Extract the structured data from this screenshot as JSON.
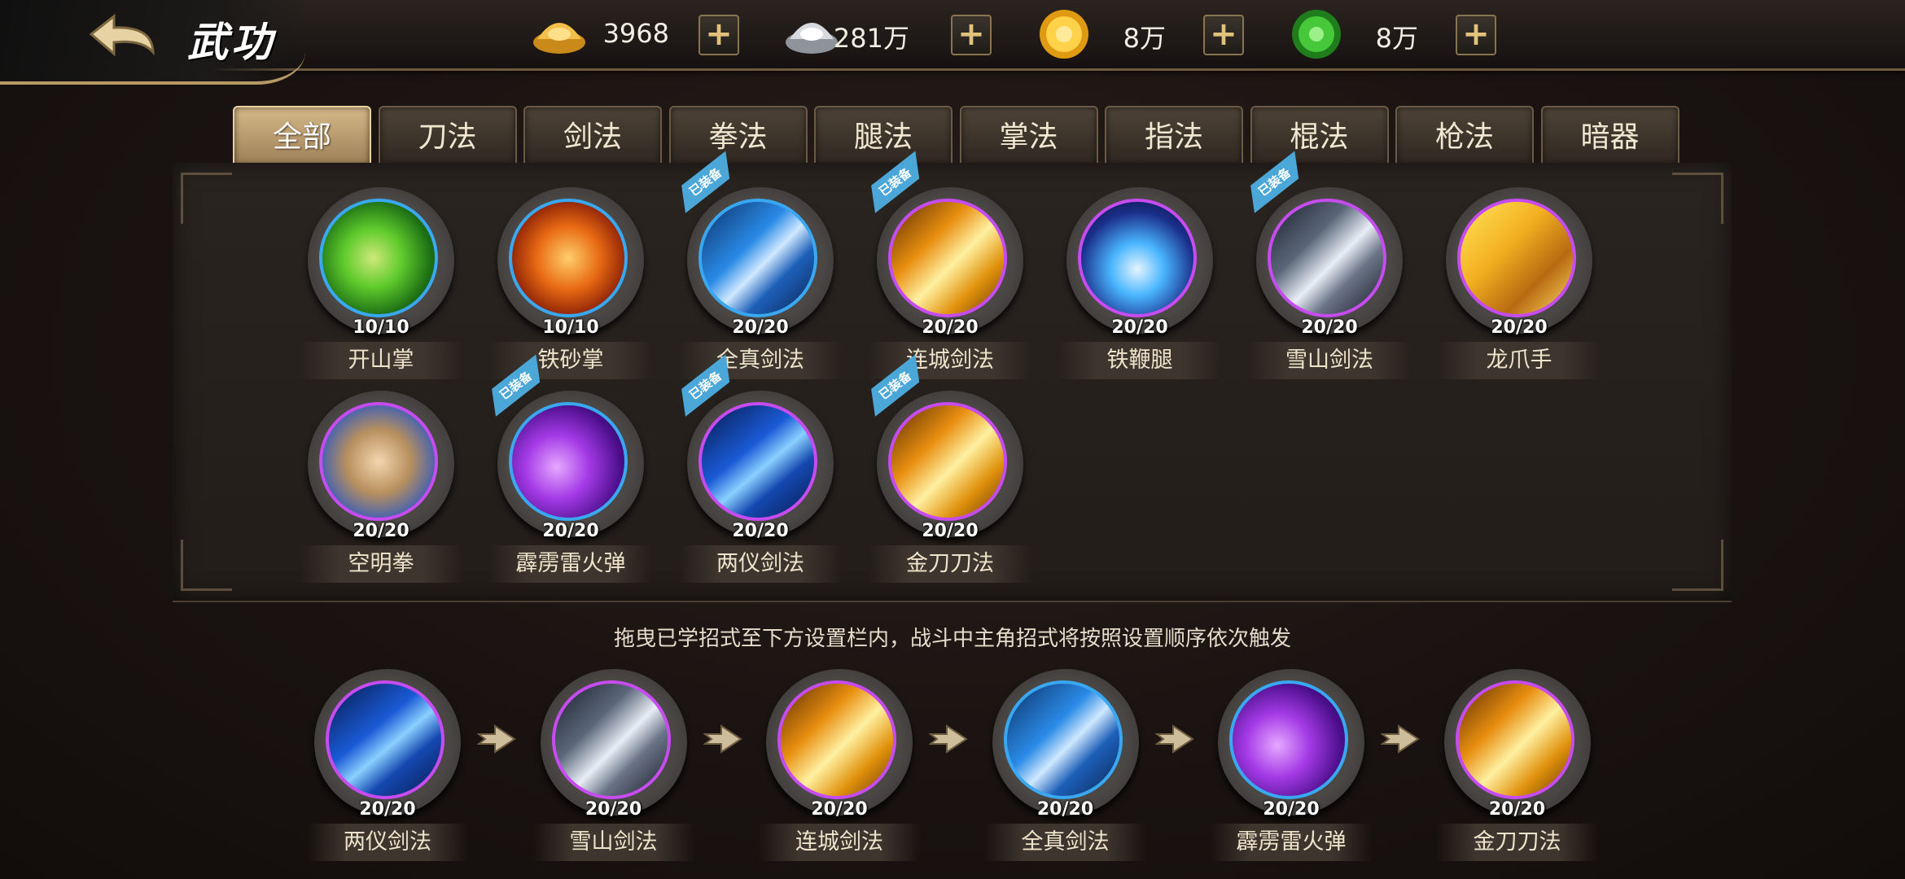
{
  "header": {
    "title": "武功",
    "currencies": [
      {
        "icon": "gold-ingot-icon",
        "value": "3968",
        "color": "#e8b43a"
      },
      {
        "icon": "silver-ingot-icon",
        "value": "281万",
        "color": "#c9ccd2"
      },
      {
        "icon": "gold-coin-icon",
        "value": "8万",
        "color": "#f1b51d"
      },
      {
        "icon": "green-jade-icon",
        "value": "8万",
        "color": "#3fbf35"
      }
    ]
  },
  "tabs": [
    "全部",
    "刀法",
    "剑法",
    "拳法",
    "腿法",
    "掌法",
    "指法",
    "棍法",
    "枪法",
    "暗器"
  ],
  "active_tab": 0,
  "equipped_label": "已装备",
  "skills": [
    {
      "name": "开山掌",
      "level": "10/10",
      "theme": "green",
      "ring": "blue",
      "equipped": false
    },
    {
      "name": "铁砂掌",
      "level": "10/10",
      "theme": "fire",
      "ring": "blue",
      "equipped": false
    },
    {
      "name": "全真剑法",
      "level": "20/20",
      "theme": "ice",
      "ring": "blue",
      "equipped": true
    },
    {
      "name": "连城剑法",
      "level": "20/20",
      "theme": "gold",
      "ring": "purple",
      "equipped": true
    },
    {
      "name": "铁鞭腿",
      "level": "20/20",
      "theme": "storm",
      "ring": "purple",
      "equipped": false
    },
    {
      "name": "雪山剑法",
      "level": "20/20",
      "theme": "silver",
      "ring": "purple",
      "equipped": true
    },
    {
      "name": "龙爪手",
      "level": "20/20",
      "theme": "amber",
      "ring": "purple",
      "equipped": false
    },
    {
      "name": "空明拳",
      "level": "20/20",
      "theme": "fist",
      "ring": "purple",
      "equipped": false
    },
    {
      "name": "霹雳雷火弹",
      "level": "20/20",
      "theme": "violet",
      "ring": "blue",
      "equipped": true
    },
    {
      "name": "两仪剑法",
      "level": "20/20",
      "theme": "deepblue",
      "ring": "purple",
      "equipped": true
    },
    {
      "name": "金刀刀法",
      "level": "20/20",
      "theme": "gold",
      "ring": "purple",
      "equipped": true
    }
  ],
  "instruction": "拖曳已学招式至下方设置栏内，战斗中主角招式将按照设置顺序依次触发",
  "sequence": [
    {
      "name": "两仪剑法",
      "level": "20/20",
      "theme": "deepblue",
      "ring": "purple"
    },
    {
      "name": "雪山剑法",
      "level": "20/20",
      "theme": "silver",
      "ring": "purple"
    },
    {
      "name": "连城剑法",
      "level": "20/20",
      "theme": "gold",
      "ring": "purple"
    },
    {
      "name": "全真剑法",
      "level": "20/20",
      "theme": "ice",
      "ring": "blue"
    },
    {
      "name": "霹雳雷火弹",
      "level": "20/20",
      "theme": "violet",
      "ring": "blue"
    },
    {
      "name": "金刀刀法",
      "level": "20/20",
      "theme": "gold",
      "ring": "purple"
    }
  ]
}
